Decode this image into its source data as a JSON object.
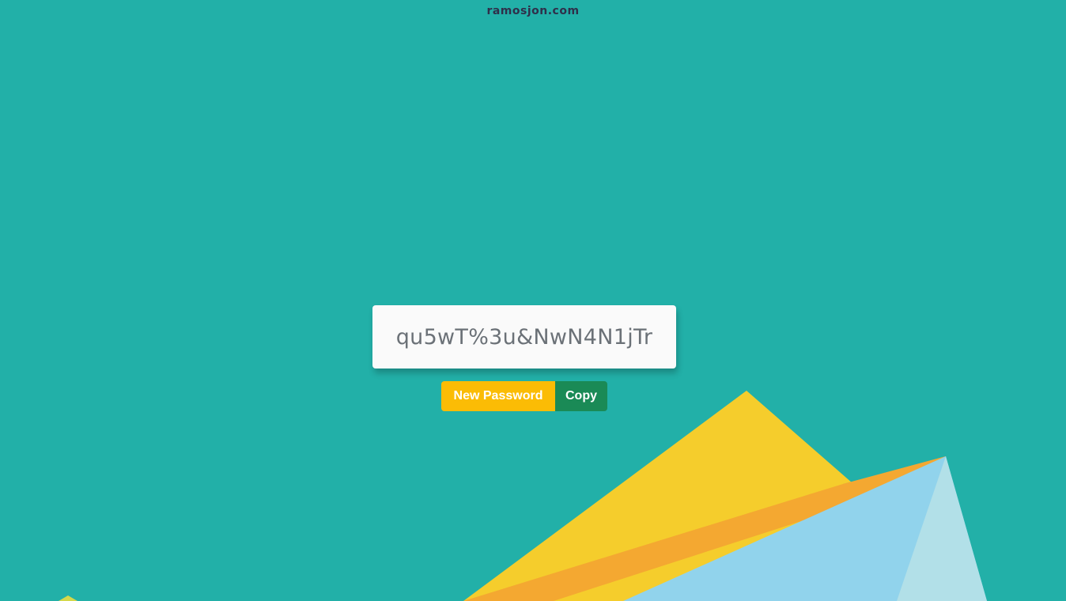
{
  "site": {
    "title": "ramosjon.com"
  },
  "password": {
    "value": "qu5wT%3u&NwN4N1jTr"
  },
  "actions": {
    "new_password_label": "New Password",
    "copy_label": "Copy"
  },
  "colors": {
    "background": "#22b0a8",
    "title_text": "#2f2f4a",
    "password_box": "#fafafa",
    "password_text": "#6b7177",
    "new_password_button": "#fbbc05",
    "copy_button": "#1a8a56",
    "shape_yellow": "#f5cd2c",
    "shape_orange": "#f4a831",
    "shape_blue": "#91d3ec",
    "shape_light_blue": "#b2e0e8"
  }
}
